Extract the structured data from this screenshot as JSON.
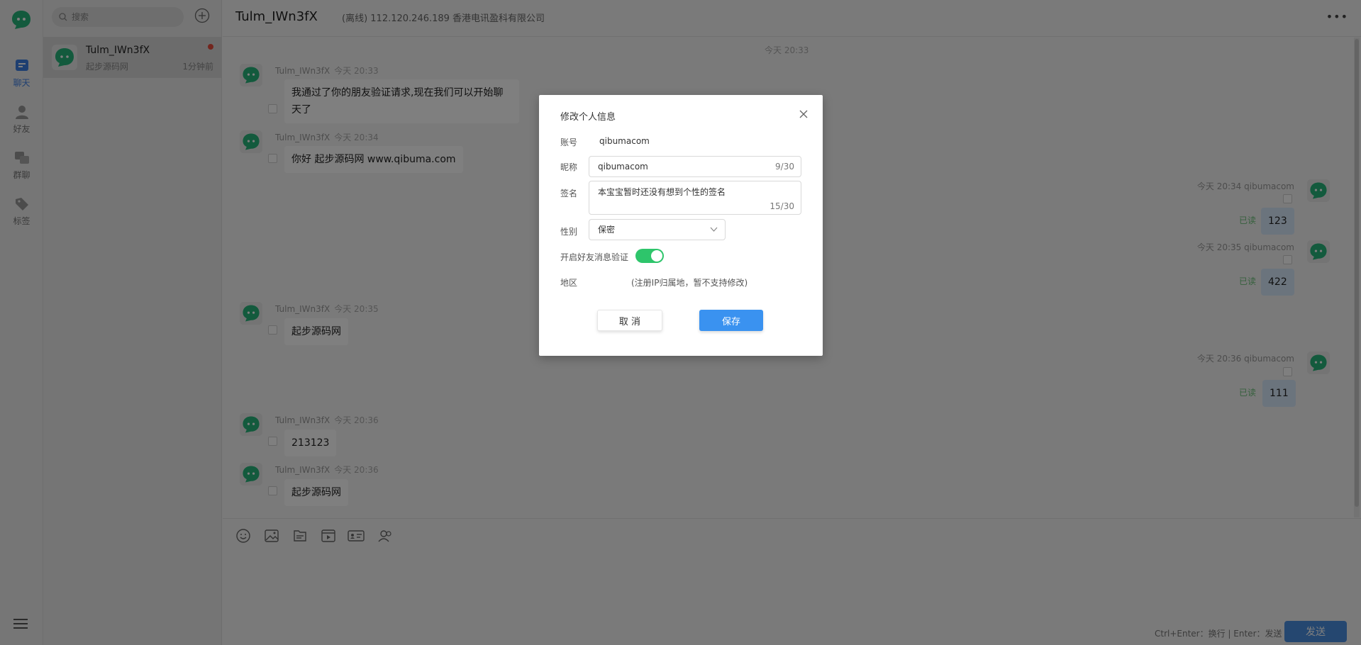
{
  "sidebar": {
    "items": [
      {
        "label": "聊天",
        "icon": "chat-icon"
      },
      {
        "label": "好友",
        "icon": "friends-icon"
      },
      {
        "label": "群聊",
        "icon": "group-icon"
      },
      {
        "label": "标签",
        "icon": "tag-icon"
      }
    ]
  },
  "convlist": {
    "search_placeholder": "搜索",
    "items": [
      {
        "name": "Tulm_IWn3fX",
        "subtitle": "起步源码网",
        "time": "1分钟前"
      }
    ]
  },
  "header": {
    "title": "Tulm_IWn3fX",
    "status": "(离线) 112.120.246.189 香港电讯盈科有限公司",
    "more": "•••"
  },
  "messages": {
    "center_time": "今天 20:33",
    "incoming": [
      {
        "sender": "Tulm_IWn3fX",
        "time": "今天 20:33",
        "text": "我通过了你的朋友验证请求,现在我们可以开始聊天了"
      },
      {
        "sender": "Tulm_IWn3fX",
        "time": "今天 20:34",
        "text": "你好 起步源码网 www.qibuma.com"
      },
      {
        "sender": "Tulm_IWn3fX",
        "time": "今天 20:35",
        "text": "起步源码网"
      },
      {
        "sender": "Tulm_IWn3fX",
        "time": "今天 20:36",
        "text": "213123"
      },
      {
        "sender": "Tulm_IWn3fX",
        "time": "今天 20:36",
        "text": "起步源码网"
      }
    ],
    "outgoing": [
      {
        "sender": "qibumacom",
        "time": "今天 20:34",
        "text": "123",
        "status": "已读"
      },
      {
        "sender": "qibumacom",
        "time": "今天 20:35",
        "text": "422",
        "status": "已读"
      },
      {
        "sender": "qibumacom",
        "time": "今天 20:36",
        "text": "111",
        "status": "已读"
      }
    ]
  },
  "input": {
    "hint": "Ctrl+Enter：换行 | Enter：发送",
    "send_label": "发送",
    "tools": [
      "emoji-icon",
      "image-icon",
      "file-icon",
      "video-icon",
      "card-icon",
      "contact-icon"
    ]
  },
  "dialog": {
    "title": "修改个人信息",
    "account_label": "账号",
    "account_value": "qibumacom",
    "nickname_label": "昵称",
    "nickname_value": "qibumacom",
    "nickname_count": "9/30",
    "signature_label": "签名",
    "signature_value": "本宝宝暂时还没有想到个性的签名",
    "signature_count": "15/30",
    "gender_label": "性别",
    "gender_value": "保密",
    "verify_label": "开启好友消息验证",
    "verify_on": true,
    "region_label": "地区",
    "region_note": "(注册IP归属地，暂不支持修改)",
    "cancel_label": "取 消",
    "save_label": "保存"
  },
  "colors": {
    "accent": "#3a92f0",
    "brand_green": "#27b57a",
    "toggle_on": "#2ec56b",
    "read_status": "#6cc07a"
  }
}
